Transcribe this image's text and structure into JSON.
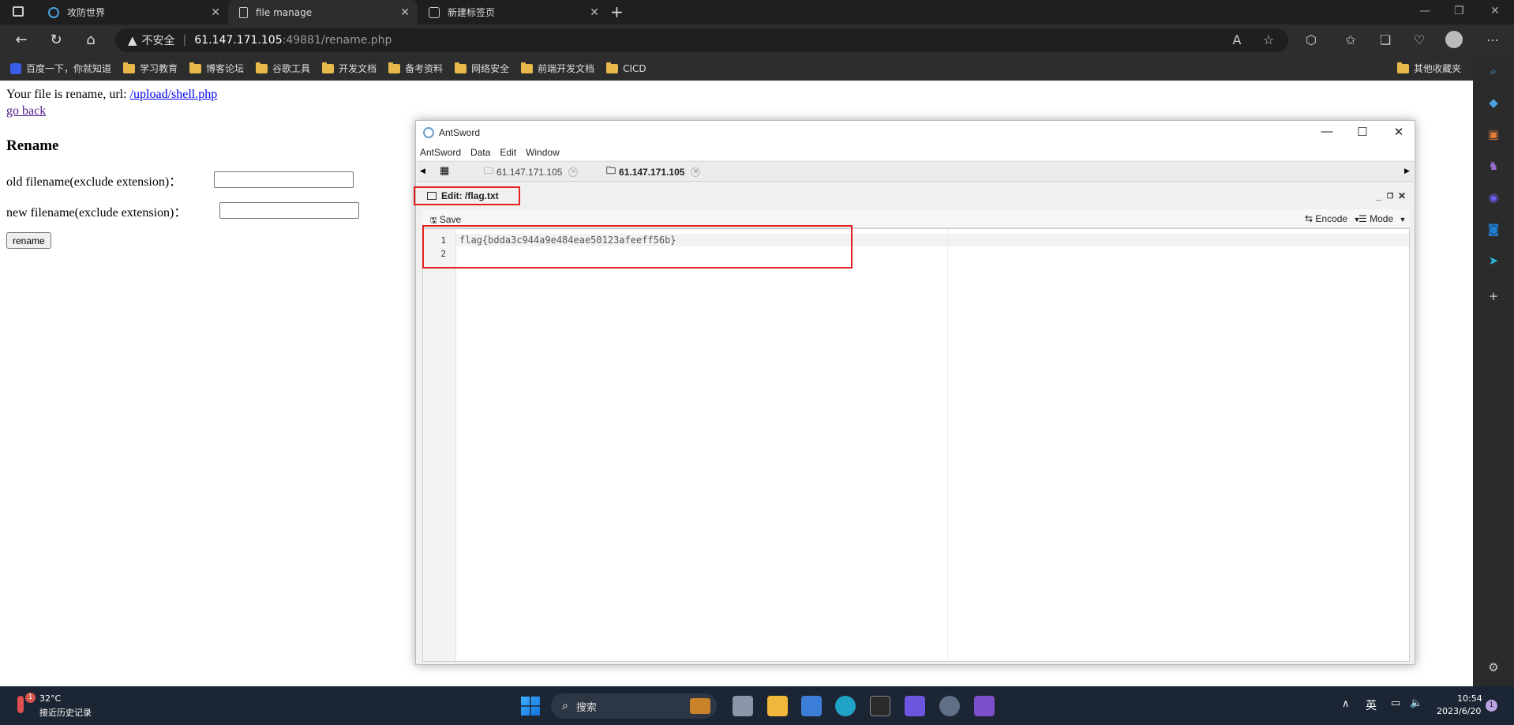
{
  "browser": {
    "tabs": [
      {
        "title": "攻防世界",
        "active": false
      },
      {
        "title": "file manage",
        "active": true
      },
      {
        "title": "新建标签页",
        "active": false
      }
    ],
    "address": {
      "security": "不安全",
      "host": "61.147.171.105",
      "path": ":49881/rename.php"
    },
    "bookmarks": [
      "百度一下，你就知道",
      "学习教育",
      "博客论坛",
      "谷歌工具",
      "开发文档",
      "备考资料",
      "网络安全",
      "前端开发文档",
      "CICD"
    ],
    "other_bookmarks": "其他收藏夹"
  },
  "page": {
    "message_prefix": "Your file is rename, url: ",
    "message_link": "/upload/shell.php",
    "go_back": "go back",
    "heading": "Rename",
    "old_label": "old filename(exclude extension)：",
    "new_label": "new filename(exclude extension)：",
    "button": "rename"
  },
  "antsword": {
    "title": "AntSword",
    "menu": [
      "AntSword",
      "Data",
      "Edit",
      "Window"
    ],
    "tabs": [
      {
        "label": "61.147.171.105",
        "active": false
      },
      {
        "label": "61.147.171.105",
        "active": true
      }
    ],
    "panel_title": "Edit: /flag.txt",
    "save": "Save",
    "encode": "Encode",
    "mode": "Mode",
    "lines": [
      {
        "num": "1",
        "text": "flag{bdda3c944a9e484eae50123afeeff56b}"
      },
      {
        "num": "2",
        "text": ""
      }
    ]
  },
  "taskbar": {
    "weather_temp": "32°C",
    "weather_desc": "接近历史记录",
    "search": "搜索",
    "ime": "英",
    "time": "10:54",
    "date": "2023/6/20",
    "notif_badge": "1",
    "weather_badge": "1"
  },
  "colors": {
    "highlight_box": "#e52020",
    "taskbar": "#1c2533"
  }
}
